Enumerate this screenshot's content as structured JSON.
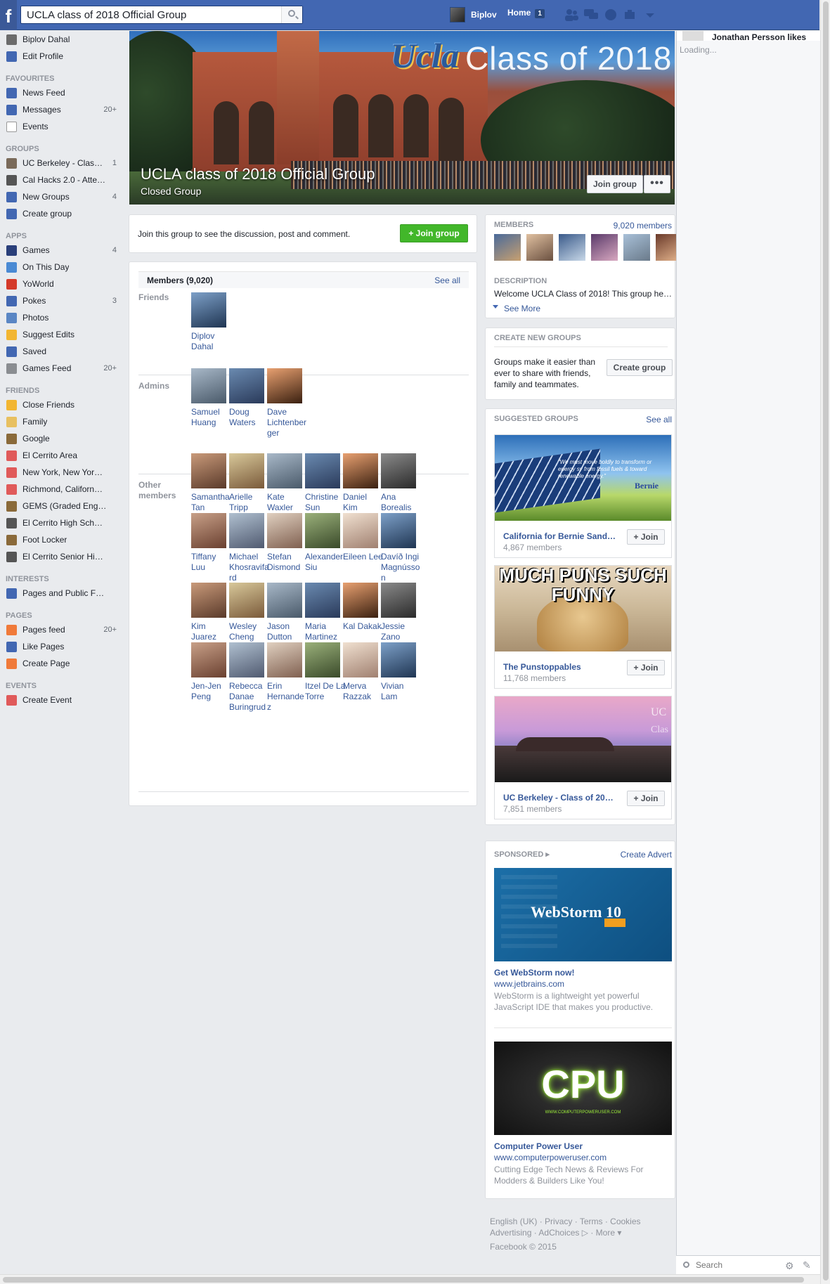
{
  "topbar": {
    "logo": "f",
    "search_value": "UCLA class of 2018 Official Group",
    "user_name": "Biplov",
    "home_label": "Home",
    "home_badge": "1",
    "icons": [
      "friends-icon",
      "messages-icon",
      "globe-icon",
      "settings-icon",
      "dropdown-icon"
    ]
  },
  "left_nav": {
    "profile": [
      {
        "label": "Biplov Dahal",
        "icon": "profile-photo-icon",
        "color": "#6b6b6b"
      },
      {
        "label": "Edit Profile",
        "icon": "edit-profile-icon",
        "color": "#4267b2"
      }
    ],
    "sections": [
      {
        "title": "FAVOURITES",
        "items": [
          {
            "label": "News Feed",
            "count": "",
            "icon": "news-feed-icon",
            "color": "#4267b2"
          },
          {
            "label": "Messages",
            "count": "20+",
            "icon": "messages-icon",
            "color": "#4267b2"
          },
          {
            "label": "Events",
            "count": "",
            "icon": "events-calendar-icon",
            "color": "#ffffff"
          }
        ]
      },
      {
        "title": "GROUPS",
        "items": [
          {
            "label": "UC Berkeley - Class…",
            "count": "1",
            "icon": "group-photo-icon",
            "color": "#7a6a5a"
          },
          {
            "label": "Cal Hacks 2.0 - Atte…",
            "count": "",
            "icon": "group-photo-icon",
            "color": "#555555"
          },
          {
            "label": "New Groups",
            "count": "4",
            "icon": "groups-icon",
            "color": "#4267b2"
          },
          {
            "label": "Create group",
            "count": "",
            "icon": "create-group-icon",
            "color": "#4267b2"
          }
        ]
      },
      {
        "title": "APPS",
        "items": [
          {
            "label": "Games",
            "count": "4",
            "icon": "games-icon",
            "color": "#2a3f7a"
          },
          {
            "label": "On This Day",
            "count": "",
            "icon": "on-this-day-icon",
            "color": "#4a8ad4"
          },
          {
            "label": "YoWorld",
            "count": "",
            "icon": "yoworld-icon",
            "color": "#d43a2a"
          },
          {
            "label": "Pokes",
            "count": "3",
            "icon": "pokes-icon",
            "color": "#4267b2"
          },
          {
            "label": "Photos",
            "count": "",
            "icon": "photos-icon",
            "color": "#5a86c4"
          },
          {
            "label": "Suggest Edits",
            "count": "",
            "icon": "suggest-edits-icon",
            "color": "#f2b632"
          },
          {
            "label": "Saved",
            "count": "",
            "icon": "saved-icon",
            "color": "#4267b2"
          },
          {
            "label": "Games Feed",
            "count": "20+",
            "icon": "games-feed-icon",
            "color": "#8a8d91"
          }
        ]
      },
      {
        "title": "FRIENDS",
        "items": [
          {
            "label": "Close Friends",
            "count": "",
            "icon": "star-icon",
            "color": "#f2b632"
          },
          {
            "label": "Family",
            "count": "",
            "icon": "family-icon",
            "color": "#e8c060"
          },
          {
            "label": "Google",
            "count": "",
            "icon": "work-icon",
            "color": "#8a6a3a"
          },
          {
            "label": "El Cerrito Area",
            "count": "",
            "icon": "location-pin-icon",
            "color": "#e05a5a"
          },
          {
            "label": "New York, New Yor…",
            "count": "",
            "icon": "location-pin-icon",
            "color": "#e05a5a"
          },
          {
            "label": "Richmond, Californ…",
            "count": "",
            "icon": "location-pin-icon",
            "color": "#e05a5a"
          },
          {
            "label": "GEMS (Graded Eng…",
            "count": "",
            "icon": "work-icon",
            "color": "#8a6a3a"
          },
          {
            "label": "El Cerrito High Sch…",
            "count": "",
            "icon": "school-icon",
            "color": "#555555"
          },
          {
            "label": "Foot Locker",
            "count": "",
            "icon": "work-icon",
            "color": "#8a6a3a"
          },
          {
            "label": "El Cerrito Senior Hi…",
            "count": "",
            "icon": "school-icon",
            "color": "#555555"
          }
        ]
      },
      {
        "title": "INTERESTS",
        "items": [
          {
            "label": "Pages and Public F…",
            "count": "",
            "icon": "interests-icon",
            "color": "#4267b2"
          }
        ]
      },
      {
        "title": "PAGES",
        "items": [
          {
            "label": "Pages feed",
            "count": "20+",
            "icon": "pages-feed-icon",
            "color": "#f07a3a"
          },
          {
            "label": "Like Pages",
            "count": "",
            "icon": "like-pages-icon",
            "color": "#4267b2"
          },
          {
            "label": "Create Page",
            "count": "",
            "icon": "create-page-icon",
            "color": "#f07a3a"
          }
        ]
      },
      {
        "title": "EVENTS",
        "items": [
          {
            "label": "Create Event",
            "count": "",
            "icon": "create-event-icon",
            "color": "#e05a5a"
          }
        ]
      }
    ]
  },
  "cover": {
    "logo_text": "Ucla",
    "cover_text": "Class of 2018",
    "group_name": "UCLA class of 2018 Official Group",
    "privacy": "Closed Group",
    "join_label": "Join group",
    "more_label": "•••"
  },
  "join_prompt": {
    "text": "Join this group to see the discussion, post and comment.",
    "button": "+ Join group"
  },
  "members": {
    "title": "Members (9,020)",
    "see_all": "See all",
    "friends_label": "Friends",
    "admins_label": "Admins",
    "other_label": "Other members",
    "friends": [
      {
        "name": "Diplov Dahal"
      }
    ],
    "admins": [
      {
        "name": "Samuel Huang"
      },
      {
        "name": "Doug Waters"
      },
      {
        "name": "Dave Lichtenberger"
      }
    ],
    "others": [
      {
        "name": "Samantha Tan"
      },
      {
        "name": "Arielle Tripp"
      },
      {
        "name": "Kate Waxler"
      },
      {
        "name": "Christine Sun"
      },
      {
        "name": "Daniel Kim"
      },
      {
        "name": "Ana Borealis"
      },
      {
        "name": "Tiffany Luu"
      },
      {
        "name": "Michael Khosravifard"
      },
      {
        "name": "Stefan Dismond"
      },
      {
        "name": "Alexander Siu"
      },
      {
        "name": "Eileen Lee"
      },
      {
        "name": "Davíð Ingi Magnússon"
      },
      {
        "name": "Kim Juarez"
      },
      {
        "name": "Wesley Cheng"
      },
      {
        "name": "Jason Dutton"
      },
      {
        "name": "Maria Martinez"
      },
      {
        "name": "Kal Dakak"
      },
      {
        "name": "Jessie Zano"
      },
      {
        "name": "Jen-Jen Peng"
      },
      {
        "name": "Rebecca Danae Buringrud"
      },
      {
        "name": "Erin Hernandez"
      },
      {
        "name": "Itzel De La Torre"
      },
      {
        "name": "Merva Razzak"
      },
      {
        "name": "Vivian Lam"
      }
    ]
  },
  "right": {
    "members_head": "MEMBERS",
    "members_count": "9,020 members",
    "desc_head": "DESCRIPTION",
    "desc_text": "Welcome UCLA Class of 2018! This group he…",
    "see_more": "See More",
    "create_head": "CREATE NEW GROUPS",
    "create_text": "Groups make it easier than ever to share with friends, family and teammates.",
    "create_btn": "Create group",
    "suggested_head": "SUGGESTED GROUPS",
    "suggested_see_all": "See all",
    "suggested": [
      {
        "name": "California for Bernie Sand…",
        "count": "4,867 members",
        "join": "+ Join"
      },
      {
        "name": "The Punstoppables",
        "count": "11,768 members",
        "join": "+ Join"
      },
      {
        "name": "UC Berkeley - Class of 20…",
        "count": "7,851 members",
        "join": "+ Join"
      }
    ],
    "sugg_img_texts": [
      "Bernie",
      "“We must move boldly to transform or energy sy from fossil fuels & toward renewable energy.”",
      "MUCH PUNS SUCH",
      "FUNNY",
      "UC",
      "Clas"
    ],
    "sponsored_head": "SPONSORED",
    "create_advert": "Create Advert",
    "ads": [
      {
        "img_text": "WebStorm 10",
        "title": "Get WebStorm now!",
        "url": "www.jetbrains.com",
        "desc": "WebStorm is a lightweight yet powerful JavaScript IDE that makes you productive."
      },
      {
        "img_text": "CPU",
        "img_sub": "WWW.COMPUTERPOWERUSER.COM",
        "title": "Computer Power User",
        "url": "www.computerpoweruser.com",
        "desc": "Cutting Edge Tech News & Reviews For Modders & Builders Like You!"
      }
    ]
  },
  "footer": {
    "links": [
      "English (UK)",
      "Privacy",
      "Terms",
      "Cookies",
      "Advertising",
      "AdChoices",
      "More"
    ],
    "copyright": "Facebook © 2015"
  },
  "ticker": {
    "name": "Jonathan Persson likes",
    "loading": "Loading...",
    "search_placeholder": "Search"
  }
}
